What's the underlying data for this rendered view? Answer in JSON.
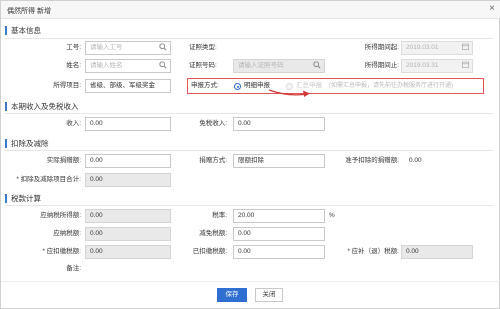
{
  "window": {
    "title": "偶然所得 新增",
    "close_glyph": "×"
  },
  "sections": {
    "basic": "基本信息",
    "income": "本期收入及免税收入",
    "deduction": "扣除及减除",
    "tax": "税款计算"
  },
  "basic": {
    "employee_id_label": "工号:",
    "employee_id_placeholder": "请输入工号",
    "id_type_label": "证照类型:",
    "period_start_label": "所得期间起:",
    "period_start_value": "2019.03.01",
    "name_label": "姓名:",
    "name_placeholder": "请输入姓名",
    "id_number_label": "证照号码:",
    "id_number_placeholder": "请输入证照号码",
    "period_end_label": "所得期间止:",
    "period_end_value": "2019.03.31",
    "income_item_label": "所得项目:",
    "income_item_value": "省级、部级、军级奖金",
    "report_mode_label": "申报方式:",
    "report_mode_options": [
      {
        "label": "明细申报",
        "selected": true
      },
      {
        "label": "汇总申报",
        "selected": false
      }
    ],
    "report_mode_hint": "(如需汇总申报，请先前往办税服务厅进行开通)"
  },
  "income": {
    "income_label": "收入:",
    "income_value": "0.00",
    "exempt_label": "免税收入:",
    "exempt_value": "0.00"
  },
  "deduction": {
    "actual_donation_label": "实际捐赠额:",
    "actual_donation_value": "0.00",
    "donation_method_label": "捐赠方式:",
    "donation_method_value": "限额扣除",
    "allowed_donation_label": "准予扣除的捐赠额:",
    "allowed_donation_value": "0.00",
    "total_label": "* 扣除及减除项目合计:",
    "total_value": "0.00"
  },
  "tax": {
    "taxable_income_label": "应纳税所得额:",
    "taxable_income_value": "0.00",
    "rate_label": "税率:",
    "rate_value": "20.00",
    "rate_unit": "%",
    "tax_payable_label": "应纳税额:",
    "tax_payable_value": "0.00",
    "tax_relief_label": "减免税额:",
    "tax_relief_value": "0.00",
    "withheld_label": "* 应扣缴税额:",
    "withheld_value": "0.00",
    "already_withheld_label": "已扣缴税额:",
    "already_withheld_value": "0.00",
    "refund_label": "* 应补（退）税额:",
    "refund_value": "0.00",
    "remark_label": "备注:"
  },
  "footer": {
    "save_label": "保存",
    "close_label": "关闭"
  },
  "colors": {
    "accent": "#2f6fd1",
    "highlight_border": "#e05555",
    "annotation_arrow": "#d23a3a"
  }
}
